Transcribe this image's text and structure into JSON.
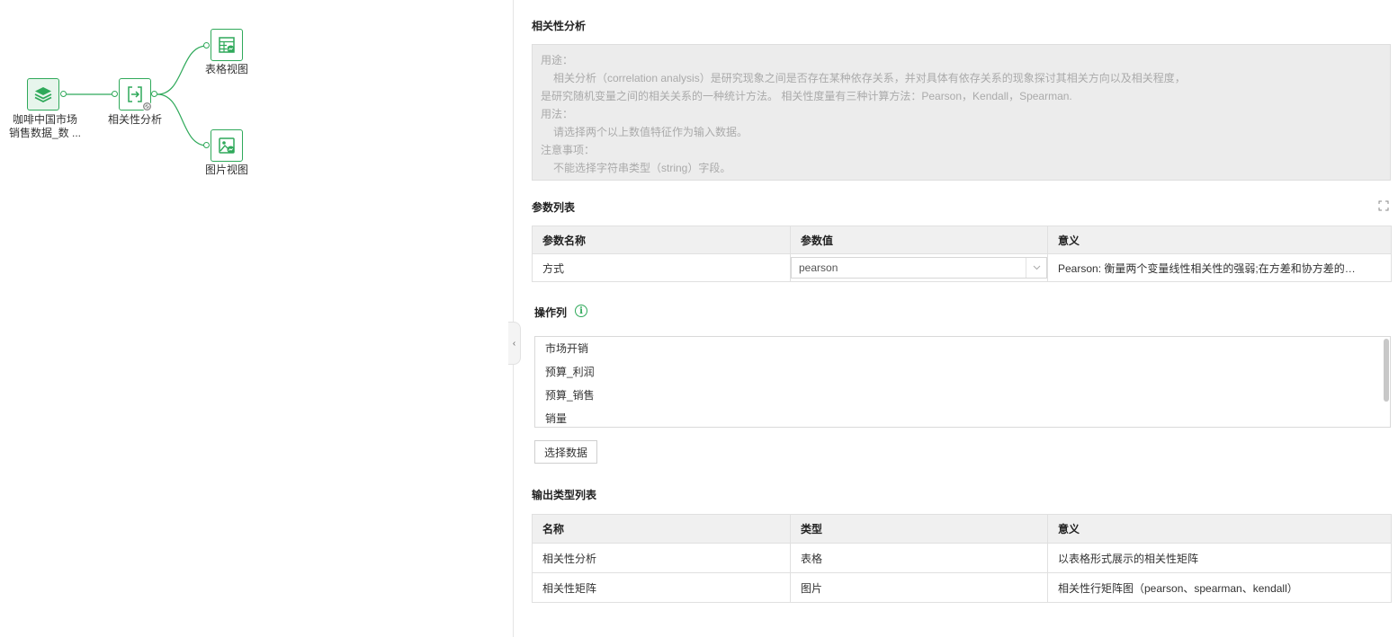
{
  "canvas": {
    "nodes": {
      "source": {
        "label_line1": "咖啡中国市场",
        "label_line2": "销售数据_数 ..."
      },
      "correlation": {
        "label": "相关性分析"
      },
      "table_view": {
        "label": "表格视图"
      },
      "image_view": {
        "label": "图片视图"
      }
    }
  },
  "panel": {
    "title": "相关性分析",
    "description": {
      "usage_heading": "用途：",
      "usage_line1": "相关分析（correlation analysis）是研究现象之间是否存在某种依存关系，并对具体有依存关系的现象探讨其相关方向以及相关程度，",
      "usage_line2": "是研究随机变量之间的相关关系的一种统计方法。 相关性度量有三种计算方法：Pearson，Kendall，Spearman.",
      "method_heading": "用法：",
      "method_line": "请选择两个以上数值特征作为输入数据。",
      "notes_heading": "注意事项：",
      "notes_line": "不能选择字符串类型（string）字段。"
    },
    "params": {
      "title": "参数列表",
      "headers": [
        "参数名称",
        "参数值",
        "意义"
      ],
      "rows": [
        {
          "name": "方式",
          "value": "pearson",
          "meaning": "Pearson: 衡量两个变量线性相关性的强弱;在方差和协方差的…"
        }
      ]
    },
    "columns": {
      "title": "操作列",
      "items": [
        "市场开销",
        "预算_利润",
        "预算_销售",
        "销量"
      ],
      "select_button": "选择数据"
    },
    "outputs": {
      "title": "输出类型列表",
      "headers": [
        "名称",
        "类型",
        "意义"
      ],
      "rows": [
        {
          "name": "相关性分析",
          "type": "表格",
          "meaning": "以表格形式展示的相关性矩阵"
        },
        {
          "name": "相关性矩阵",
          "type": "图片",
          "meaning": "相关性行矩阵图（pearson、spearman、kendall）"
        }
      ]
    }
  },
  "colors": {
    "accent": "#2fa95a",
    "desc_bg": "#ececec",
    "header_bg": "#f0f0f0"
  }
}
